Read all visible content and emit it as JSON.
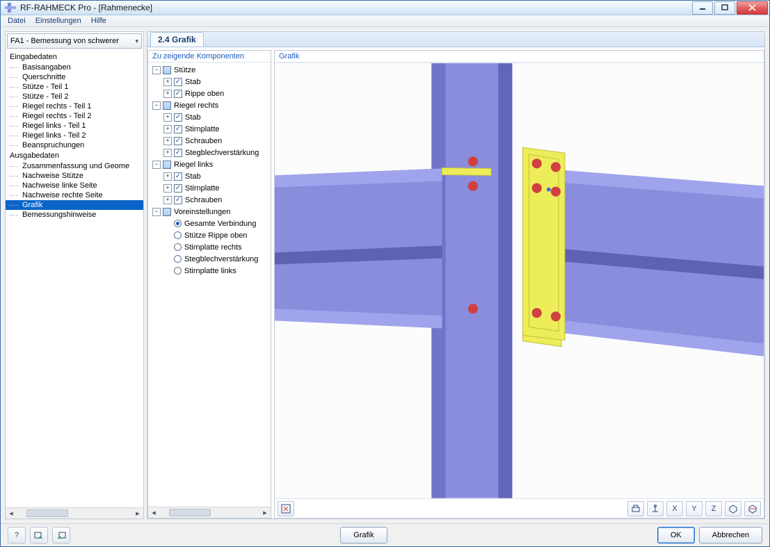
{
  "window": {
    "title": "RF-RAHMECK Pro - [Rahmenecke]"
  },
  "menu": {
    "items": [
      "Datei",
      "Einstellungen",
      "Hilfe"
    ]
  },
  "caseSelector": {
    "value": "FA1 - Bemessung von schwerer"
  },
  "nav": {
    "groups": [
      {
        "label": "Eingabedaten",
        "items": [
          "Basisangaben",
          "Querschnitte",
          "Stütze - Teil 1",
          "Stütze - Teil 2",
          "Riegel rechts - Teil 1",
          "Riegel rechts - Teil 2",
          "Riegel links - Teil 1",
          "Riegel links - Teil 2",
          "Beanspruchungen"
        ]
      },
      {
        "label": "Ausgabedaten",
        "items": [
          "Zusammenfassung und Geome",
          "Nachweise Stütze",
          "Nachweise linke Seite",
          "Nachweise rechte Seite",
          "Grafik",
          "Bemessungshinweise"
        ]
      }
    ],
    "selected": "Grafik"
  },
  "tab": {
    "label": "2.4 Grafik"
  },
  "componentsPanel": {
    "title": "Zu zeigende Komponenten",
    "tree": [
      {
        "level": 0,
        "exp": "-",
        "box": "mixed",
        "label": "Stütze"
      },
      {
        "level": 1,
        "exp": "+",
        "box": "check",
        "label": "Stab"
      },
      {
        "level": 1,
        "exp": "+",
        "box": "check",
        "label": "Rippe oben"
      },
      {
        "level": 0,
        "exp": "-",
        "box": "mixed",
        "label": "Riegel rechts"
      },
      {
        "level": 1,
        "exp": "+",
        "box": "check",
        "label": "Stab"
      },
      {
        "level": 1,
        "exp": "+",
        "box": "check",
        "label": "Stirnplatte"
      },
      {
        "level": 1,
        "exp": "+",
        "box": "check",
        "label": "Schrauben"
      },
      {
        "level": 1,
        "exp": "+",
        "box": "check",
        "label": "Stegblechverstärkung"
      },
      {
        "level": 0,
        "exp": "-",
        "box": "mixed",
        "label": "Riegel links"
      },
      {
        "level": 1,
        "exp": "+",
        "box": "check",
        "label": "Stab"
      },
      {
        "level": 1,
        "exp": "+",
        "box": "check",
        "label": "Stirnplatte"
      },
      {
        "level": 1,
        "exp": "+",
        "box": "check",
        "label": "Schrauben"
      },
      {
        "level": 0,
        "exp": "-",
        "box": "mixed",
        "label": "Voreinstellungen"
      },
      {
        "level": 1,
        "exp": "",
        "box": "radio-on",
        "label": "Gesamte Verbindung"
      },
      {
        "level": 1,
        "exp": "",
        "box": "radio",
        "label": "Stütze Rippe oben"
      },
      {
        "level": 1,
        "exp": "",
        "box": "radio",
        "label": "Stirnplatte rechts"
      },
      {
        "level": 1,
        "exp": "",
        "box": "radio",
        "label": "Stegblechverstärkung"
      },
      {
        "level": 1,
        "exp": "",
        "box": "radio",
        "label": "Stirnplatte links"
      }
    ]
  },
  "grafikPanel": {
    "title": "Grafik"
  },
  "toolbar": {
    "items": [
      "print-icon",
      "anchor-icon",
      "x-axis-icon",
      "y-axis-icon",
      "z-axis-icon",
      "iso-icon",
      "layers-icon"
    ]
  },
  "bottom": {
    "grafik": "Grafik",
    "ok": "OK",
    "cancel": "Abbrechen"
  }
}
